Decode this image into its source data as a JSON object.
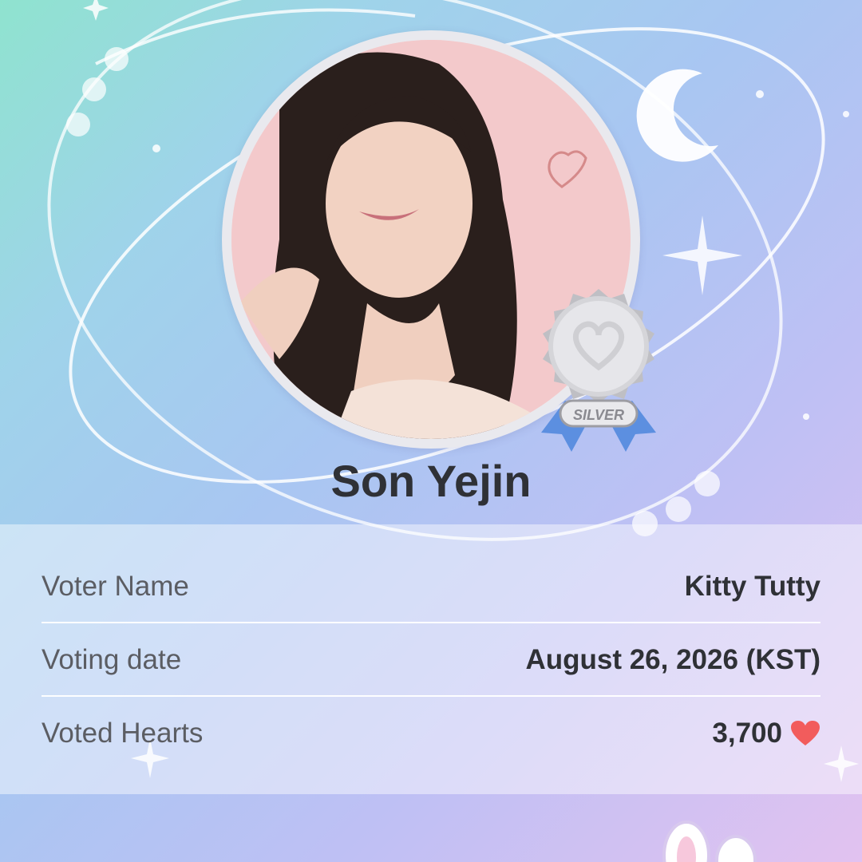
{
  "idol": {
    "name": "Son Yejin"
  },
  "badge": {
    "label": "SILVER"
  },
  "info": {
    "rows": [
      {
        "label": "Voter Name",
        "value": "Kitty Tutty"
      },
      {
        "label": "Voting date",
        "value": "August 26, 2026 (KST)"
      },
      {
        "label": "Voted Hearts",
        "value": "3,700",
        "icon": "heart-icon"
      }
    ]
  },
  "colors": {
    "heart": "#f25c5c",
    "ribbon": "#5c8fe0",
    "medal": "#cfcfd3"
  }
}
